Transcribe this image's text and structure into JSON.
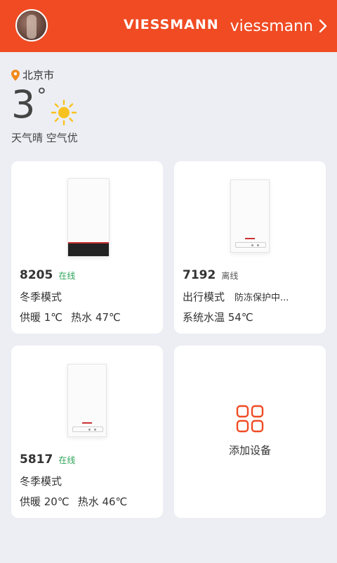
{
  "header": {
    "brand_logo_text": "VIESSMANN",
    "brand_link_text": "viessmann"
  },
  "weather": {
    "city": "北京市",
    "temperature": "3",
    "degree_symbol": "°",
    "description": "天气晴 空气优"
  },
  "devices": [
    {
      "id": "8205",
      "status": "在线",
      "mode": "冬季模式",
      "mode_note": "",
      "heating": "供暖  1℃",
      "hot_water": "热水  47℃"
    },
    {
      "id": "7192",
      "status": "离线",
      "mode": "出行模式",
      "mode_note": "防冻保护中...",
      "system_temp": "系统水温  54℃"
    },
    {
      "id": "5817",
      "status": "在线",
      "mode": "冬季模式",
      "mode_note": "",
      "heating": "供暖  20℃",
      "hot_water": "热水  46℃"
    }
  ],
  "add_device": {
    "label": "添加设备"
  },
  "colors": {
    "brand_orange": "#f04b23",
    "online_green": "#2fa55a",
    "sun_yellow": "#f7c21f"
  },
  "icons": [
    "location-pin-icon",
    "sun-icon",
    "chevron-right-icon",
    "add-device-grid-icon"
  ]
}
